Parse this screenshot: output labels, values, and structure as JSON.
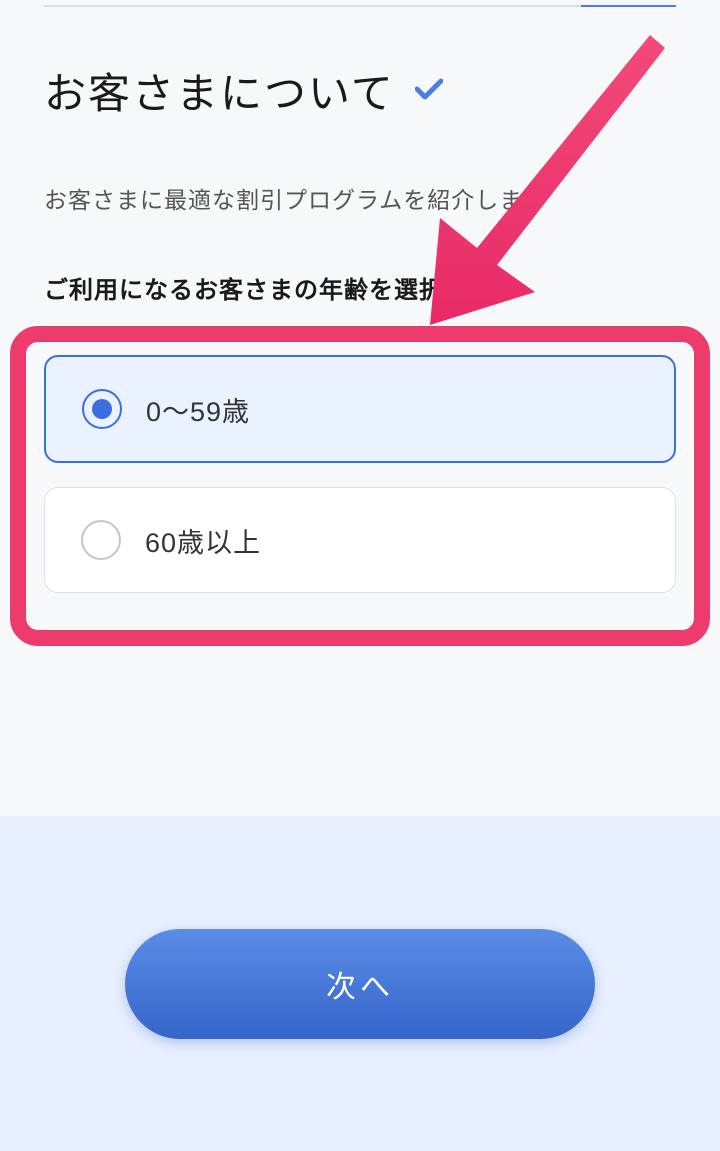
{
  "header": {
    "title": "お客さまについて"
  },
  "subtitle": "お客さまに最適な割引プログラムを紹介します",
  "question": "ご利用になるお客さまの年齢を選択",
  "options": [
    {
      "label": "0〜59歳",
      "selected": true
    },
    {
      "label": "60歳以上",
      "selected": false
    }
  ],
  "footer": {
    "next_label": "次へ"
  },
  "annotation": {
    "highlight_color": "#ed3b6b"
  }
}
